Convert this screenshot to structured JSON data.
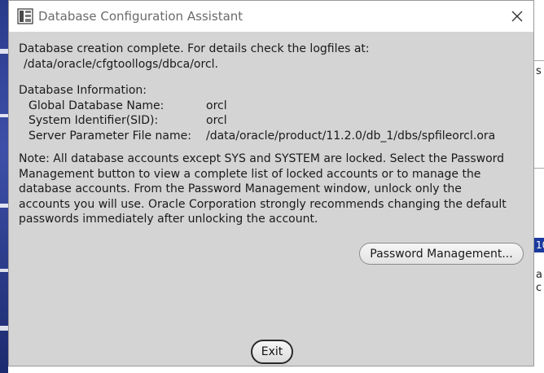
{
  "window": {
    "title": "Database Configuration Assistant"
  },
  "message": {
    "line1": "Database creation complete. For details check the logfiles at:",
    "line2": "/data/oracle/cfgtoollogs/dbca/orcl."
  },
  "info": {
    "heading": "Database Information:",
    "rows": [
      {
        "key": "Global Database Name:",
        "value": "orcl"
      },
      {
        "key": "System Identifier(SID):",
        "value": "orcl"
      },
      {
        "key": "Server Parameter File name:",
        "value": "/data/oracle/product/11.2.0/db_1/dbs/spfileorcl.ora"
      }
    ]
  },
  "note": [
    "Note: All database accounts except SYS and SYSTEM are locked. Select the Password",
    "Management button to view a complete list of locked accounts or to manage the",
    "database accounts. From the Password Management window, unlock only the",
    "accounts you will use. Oracle Corporation strongly recommends changing the default",
    "passwords immediately after unlocking the account."
  ],
  "buttons": {
    "password_management": "Password Management...",
    "exit": "Exit"
  },
  "background": {
    "frag1": "s",
    "frag2": "10",
    "frag3": "a",
    "frag4": "c"
  },
  "colors": {
    "dialog_bg": "#d4d4d4",
    "titlebar_bg": "#ffffff",
    "selection": "#1a3a9e"
  }
}
